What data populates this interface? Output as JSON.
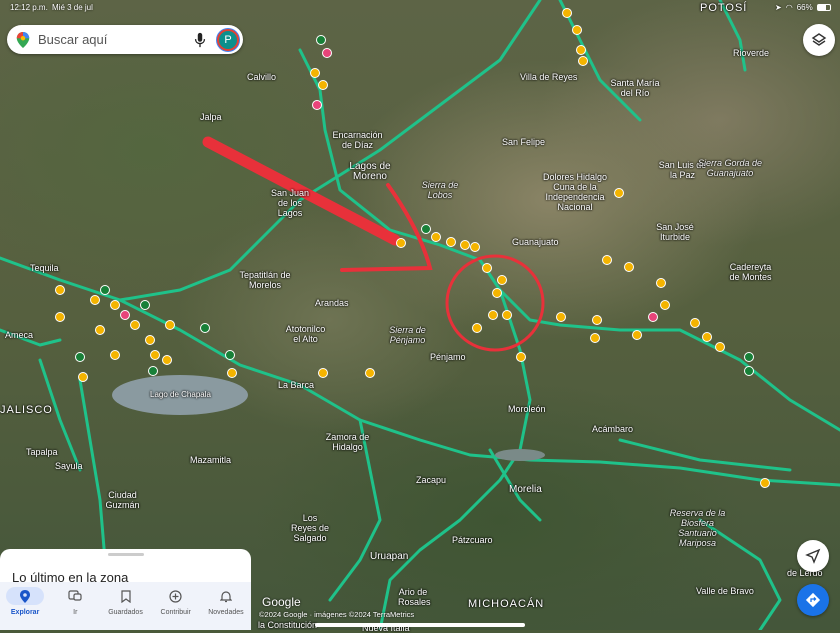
{
  "status_bar": {
    "time": "12:12 p.m.",
    "date": "Mié 3 de jul",
    "battery": "66%"
  },
  "search": {
    "placeholder": "Buscar aquí",
    "avatar_letter": "P"
  },
  "map_labels": {
    "potosi": "POTOSÍ",
    "rioverde": "Rioverde",
    "villa_de_reyes": "Villa de Reyes",
    "santa_maria": "Santa María del Río",
    "calvillo": "Calvillo",
    "jalpa": "Jalpa",
    "encarnacion": "Encarnación de Díaz",
    "lagos": "Lagos de Moreno",
    "san_felipe": "San Felipe",
    "san_juan": "San Juan de los Lagos",
    "sierra_lobos": "Sierra de Lobos",
    "dolores": "Dolores Hidalgo Cuna de la Independencia Nacional",
    "san_luis_paz": "San Luis de la Paz",
    "sierra_gorda": "Sierra Gorda de Guanajuato",
    "guanajuato": "Guanajuato",
    "san_jose": "San José Iturbide",
    "tequila": "Tequila",
    "tepatitlan": "Tepatitlán de Morelos",
    "arandas": "Arandas",
    "cadereyta": "Cadereyta de Montes",
    "atotonilco": "Atotonilco el Alto",
    "sierra_penjamo": "Sierra de Pénjamo",
    "penjamo": "Pénjamo",
    "ameca": "Ameca",
    "jalisco": "JALISCO",
    "lago_chapala": "Lago de Chapala",
    "la_barca": "La Barca",
    "moroleon": "Moroleón",
    "acambaro": "Acámbaro",
    "zamora": "Zamora de Hidalgo",
    "mazamitla": "Mazamitla",
    "tapalpa": "Tapalpa",
    "sayula": "Sayula",
    "zacapu": "Zacapu",
    "morelia": "Morelia",
    "ciudad_guzman": "Ciudad Guzmán",
    "los_reyes": "Los Reyes de Salgado",
    "patzcuaro": "Pátzcuaro",
    "uruapan": "Uruapan",
    "reserva": "Reserva de la Biosfera Santuario Mariposa",
    "valle_bravo": "Valle de Bravo",
    "michoacan": "MICHOACÁN",
    "ario": "Ario de Rosales",
    "nueva_italia": "Nueva Italia",
    "la_constitucion": "la Constitución",
    "toluca": "de Lerdo"
  },
  "sheet": {
    "title": "Lo último en la zona"
  },
  "nav": [
    {
      "label": "Explorar",
      "icon": "location-pin-icon",
      "active": true
    },
    {
      "label": "Ir",
      "icon": "commute-icon"
    },
    {
      "label": "Guardados",
      "icon": "bookmark-icon"
    },
    {
      "label": "Contribuir",
      "icon": "add-circle-icon"
    },
    {
      "label": "Novedades",
      "icon": "bell-icon"
    }
  ],
  "attribution": {
    "logo": "Google",
    "copyright": "©2024 Google · imágenes ©2024 TerraMetrics"
  },
  "colors": {
    "road": "#1fc28a",
    "annotation": "#e8313a",
    "pin": "#f4b400"
  }
}
